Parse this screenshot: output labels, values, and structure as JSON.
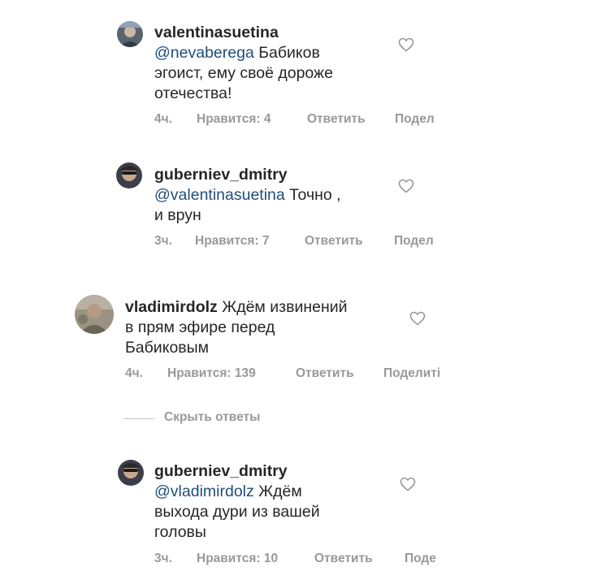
{
  "comments": [
    {
      "username": "valentinasuetina",
      "mention": "@nevaberega",
      "text_after_mention": " Бабиков",
      "line2": "эгоист, ему своё дороже",
      "line3": "отечества!",
      "time": "4ч.",
      "likes": "Нравится: 4",
      "reply": "Ответить",
      "share": "Подел"
    },
    {
      "username": "guberniev_dmitry",
      "mention": "@valentinasuetina",
      "text_after_mention": " Точно ,",
      "line2": "и врун",
      "time": "3ч.",
      "likes": "Нравится: 7",
      "reply": "Ответить",
      "share": "Подел"
    },
    {
      "username": "vladimirdolz",
      "line1_text": " Ждём извинений",
      "line2": "в прям эфире перед",
      "line3": "Бабиковым",
      "time": "4ч.",
      "likes": "Нравится: 139",
      "reply": "Ответить",
      "share": "Поделиті"
    },
    {
      "username": "guberniev_dmitry",
      "mention": "@vladimirdolz",
      "text_after_mention": " Ждём",
      "line2": "выхода дури из вашей",
      "line3": "головы",
      "time": "3ч.",
      "likes": "Нравится: 10",
      "reply": "Ответить",
      "share": "Поде"
    }
  ],
  "hide_replies": "Скрыть ответы",
  "icons": {
    "like": "heart-outline-icon"
  },
  "colors": {
    "mention": "#1f4e79",
    "meta": "#999999",
    "text": "#262626"
  }
}
